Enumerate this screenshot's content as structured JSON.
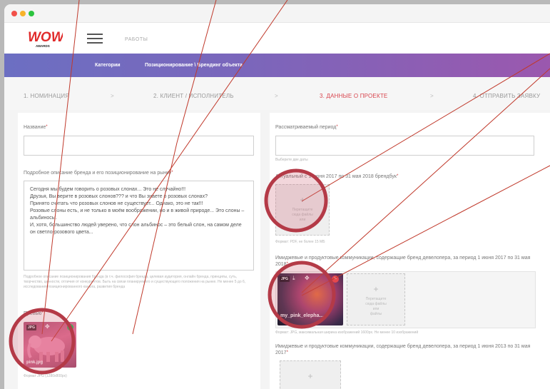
{
  "header": {
    "logo_text": "WOW",
    "logo_sub": "AWARDS",
    "menu_item": "РАБОТЫ"
  },
  "nav": {
    "categories": "Категории",
    "path": "Позиционирование \\ Брендинг объекта"
  },
  "steps": {
    "items": [
      {
        "label": "1. НОМИНАЦИЯ"
      },
      {
        "label": "2. КЛИЕНТ / ИСПОЛНИТЕЛЬ"
      },
      {
        "label": "3. ДАННЫЕ О ПРОЕКТЕ"
      },
      {
        "label": "4. ОТПРАВИТЬ ЗАЯВКУ"
      }
    ],
    "separator": ">"
  },
  "form": {
    "name_label": "Название",
    "period_label": "Рассматриваемый период",
    "period_hint": "Выберите две даты",
    "desc_label": "Подробное описание бренда и его позиционирование на рынке",
    "desc_text": "Сегодня мы будем говорить о розовых слонах... Это не случайно!!!\nДрузья,  Вы верите в розовых слонов??? и что Вы знаете о розовых слонах?\nПринято считать  что розовых слонов не существует... Однако, это не так!!!\nРозовые слоны есть, и не только в моём воображении, но и в живой природе... Это слоны – альбиносы.\nИ, хотя, большинство людей уверено, что слон альбинос – это белый слон, на самом деле он светло-розового цвета...",
    "desc_hint": "Подробное описание позиционирования бренда (в т.ч. философия бренда, целевая аудитория, онлайн бренда, принципы, суть, творчество, ценности, отличия от конкурентов. Быть на связи планируемого и существующего положения на рынке. Не менее 5 до 6, исследования позиционированного канала, развития бренда",
    "preview_label": "Превью",
    "preview_file": "pink.jpg",
    "preview_badge": "JPG",
    "preview_hint": "Формат JPG (1280х800px)",
    "brandbook_label": "Актуальный с 1 июня 2017 по 31 мая 2018 брендбук",
    "brandbook_upload": "Перетащите\nсюда файлы\nили",
    "brandbook_hint": "Формат: PDF, не более 15 МБ",
    "comm1_label": "Имиджевые и продуктовые коммуникации, содержащие бренд девелопера, за период 1 июня 2017 по 31 мая 2018",
    "comm1_file": "my_pink_elepha...",
    "comm1_badge": "JPG",
    "comm1_upload": "Перетащите\nсюда файлы\nили\nфайлы",
    "comm1_hint": "Формат: JPG, максимальная ширина изображений 1600px. Не менее 10 изображений",
    "comm2_label": "Имиджевые и продуктовые коммуникации, содержащие бренд девелопера, за период 1 июня 2013 по 31 мая 2017",
    "required_mark": "*"
  },
  "colors": {
    "accent": "#d8454e",
    "nav_start": "#6c6fc2",
    "nav_end": "#9b58ae",
    "annotation": "#c0392b"
  }
}
